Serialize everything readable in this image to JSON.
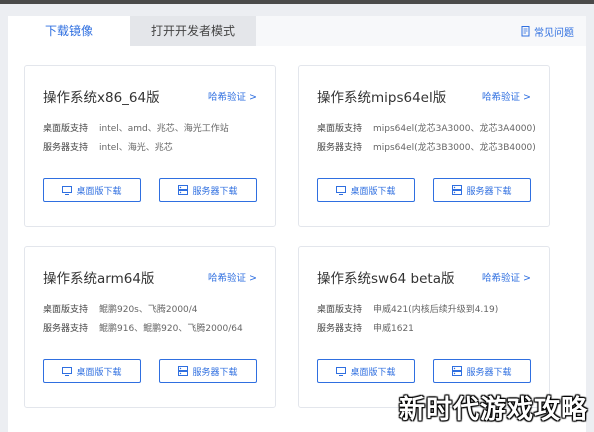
{
  "tabs": [
    {
      "label": "下载镜像",
      "active": true
    },
    {
      "label": "打开开发者模式",
      "active": false
    }
  ],
  "help": {
    "label": "常见问题",
    "icon": "document-icon"
  },
  "cards": [
    {
      "title": "操作系统x86_64版",
      "verify": "哈希验证 >",
      "desktop_label": "桌面版支持",
      "desktop_value": "intel、amd、兆芯、海光工作站",
      "server_label": "服务器支持",
      "server_value": "intel、海光、兆芯",
      "desktop_btn": "桌面版下载",
      "server_btn": "服务器下载"
    },
    {
      "title": "操作系统mips64el版",
      "verify": "哈希验证 >",
      "desktop_label": "桌面版支持",
      "desktop_value": "mips64el(龙芯3A3000、龙芯3A4000)",
      "server_label": "服务器支持",
      "server_value": "mips64el(龙芯3B3000、龙芯3B4000)",
      "desktop_btn": "桌面版下载",
      "server_btn": "服务器下载"
    },
    {
      "title": "操作系统arm64版",
      "verify": "哈希验证 >",
      "desktop_label": "桌面版支持",
      "desktop_value": "鲲鹏920s、飞腾2000/4",
      "server_label": "服务器支持",
      "server_value": "鲲鹏916、鲲鹏920、飞腾2000/64",
      "desktop_btn": "桌面版下载",
      "server_btn": "服务器下载"
    },
    {
      "title": "操作系统sw64 beta版",
      "verify": "哈希验证 >",
      "desktop_label": "桌面版支持",
      "desktop_value": "申威421(内核后续升级到4.19)",
      "server_label": "服务器支持",
      "server_value": "申威1621",
      "desktop_btn": "桌面版下载",
      "server_btn": "服务器下载"
    }
  ],
  "watermark": "新时代游戏攻略",
  "colors": {
    "accent": "#2f6fe0",
    "border": "#e3e6ec"
  }
}
